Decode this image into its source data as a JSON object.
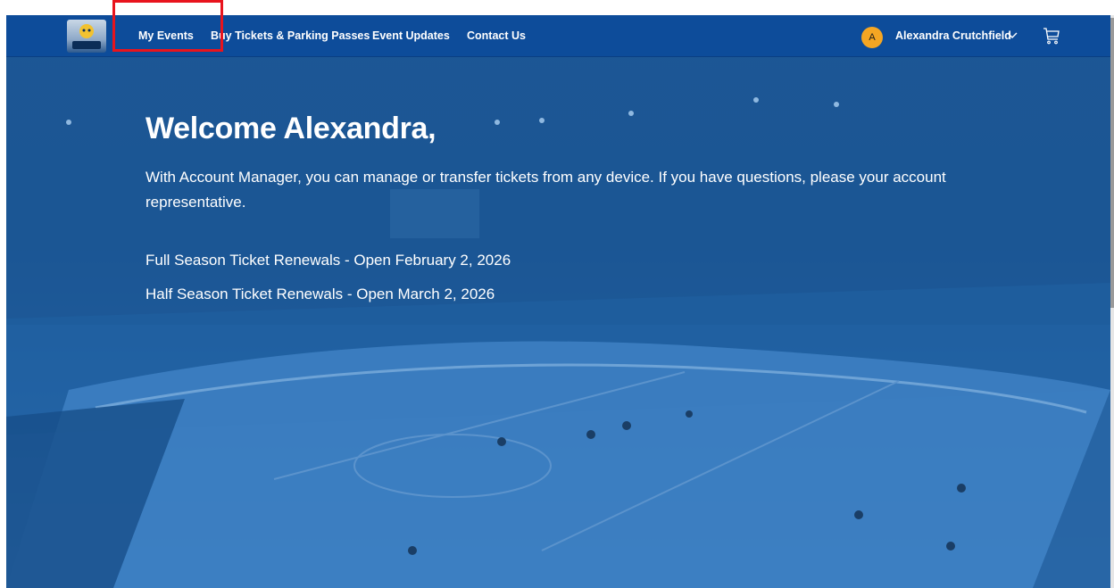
{
  "nav": {
    "logo_alt": "DAWGS",
    "links": [
      {
        "label": "My Events"
      },
      {
        "label": "Buy Tickets & Parking Passes"
      },
      {
        "label": "Event Updates"
      },
      {
        "label": "Contact Us"
      }
    ],
    "user": {
      "initial": "A",
      "name": "Alexandra Crutchfield"
    },
    "icons": {
      "user_menu": "chevron-down-icon",
      "cart": "cart-icon"
    }
  },
  "hero": {
    "heading": "Welcome Alexandra,",
    "intro": "With Account Manager, you can manage or transfer tickets from any device. If you have questions, please your account representative.",
    "renewals": [
      "Full Season Ticket Renewals - Open February 2, 2026",
      "Half Season Ticket Renewals - Open March 2, 2026"
    ]
  },
  "colors": {
    "nav_bg": "#0d4c9a",
    "hero_overlay": "#1c5a9c",
    "avatar_bg": "#f5a623",
    "highlight": "#e8141d"
  }
}
